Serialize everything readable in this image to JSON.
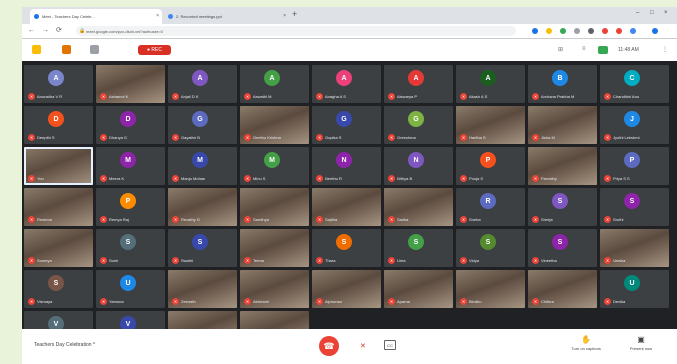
{
  "browser": {
    "tabs": [
      {
        "label": "Meet - Teachers Day Celebr...",
        "favicon_color": "#1a73e8",
        "active": true
      },
      {
        "label": "2. Recorded meetings.ppt",
        "favicon_color": "#4285f4",
        "active": false
      }
    ],
    "new_tab_symbol": "+",
    "win_controls": [
      "–",
      "□",
      "×"
    ],
    "url": "meet.google.com/pzc-dkcb-vnt?authuser=0",
    "nav_icons": [
      "←",
      "→",
      "⟳"
    ]
  },
  "meet_top": {
    "rec_label": "● REC",
    "clock": "11:48 AM",
    "right_icons": [
      "⊞",
      "≡",
      "⋮"
    ]
  },
  "participants": [
    {
      "initial": "A",
      "name": "Anuradha V R",
      "color": "#7986cb",
      "video": false
    },
    {
      "initial": "",
      "name": "Ashamol K",
      "color": "",
      "video": true
    },
    {
      "initial": "A",
      "name": "Anjali D K",
      "color": "#7e57c2",
      "video": false
    },
    {
      "initial": "A",
      "name": "Aswathi M",
      "color": "#43a047",
      "video": false
    },
    {
      "initial": "A",
      "name": "Anagha A S",
      "color": "#ec407a",
      "video": false
    },
    {
      "initial": "A",
      "name": "Aiswarya P",
      "color": "#e53935",
      "video": false
    },
    {
      "initial": "A",
      "name": "Akash A S",
      "color": "#1b5e20",
      "video": false
    },
    {
      "initial": "B",
      "name": "Archana Prabha M",
      "color": "#1e88e5",
      "video": false
    },
    {
      "initial": "C",
      "name": "Chandhini Anu",
      "color": "#00acc1",
      "video": false
    },
    {
      "initial": "D",
      "name": "Deepthi S",
      "color": "#f4511e",
      "video": false
    },
    {
      "initial": "D",
      "name": "Dhanya G",
      "color": "#8e24aa",
      "video": false
    },
    {
      "initial": "G",
      "name": "Gayathri B",
      "color": "#5c6bc0",
      "video": false
    },
    {
      "initial": "",
      "name": "Geethu Krishna",
      "color": "",
      "video": true
    },
    {
      "initial": "G",
      "name": "Gopika S",
      "color": "#3949ab",
      "video": false
    },
    {
      "initial": "G",
      "name": "Greeshma",
      "color": "#7cb342",
      "video": false
    },
    {
      "initial": "",
      "name": "Haritha S",
      "color": "",
      "video": true
    },
    {
      "initial": "",
      "name": "Jisha M",
      "color": "",
      "video": true
    },
    {
      "initial": "J",
      "name": "Jyothi Lekshmi",
      "color": "#1e88e5",
      "video": false
    },
    {
      "initial": "",
      "name": "You",
      "color": "",
      "video": true,
      "selected": true
    },
    {
      "initial": "M",
      "name": "Meera K",
      "color": "#8e24aa",
      "video": false
    },
    {
      "initial": "M",
      "name": "Manju Mohan",
      "color": "#3949ab",
      "video": false
    },
    {
      "initial": "M",
      "name": "Minu S",
      "color": "#43a047",
      "video": false
    },
    {
      "initial": "N",
      "name": "Neethu R",
      "color": "#8e24aa",
      "video": false
    },
    {
      "initial": "N",
      "name": "Nithya B",
      "color": "#7e57c2",
      "video": false
    },
    {
      "initial": "P",
      "name": "Pooja S",
      "color": "#f4511e",
      "video": false
    },
    {
      "initial": "",
      "name": "Parvathy",
      "color": "",
      "video": true
    },
    {
      "initial": "P",
      "name": "Priya S S",
      "color": "#5c6bc0",
      "video": false
    },
    {
      "initial": "",
      "name": "Reshma",
      "color": "",
      "video": true
    },
    {
      "initial": "P",
      "name": "Remya Raj",
      "color": "#fb8c00",
      "video": false
    },
    {
      "initial": "",
      "name": "Revathy G",
      "color": "",
      "video": true
    },
    {
      "initial": "",
      "name": "Sandhya",
      "color": "",
      "video": true
    },
    {
      "initial": "",
      "name": "Sajitha",
      "color": "",
      "video": true
    },
    {
      "initial": "",
      "name": "Sarika",
      "color": "",
      "video": true
    },
    {
      "initial": "R",
      "name": "Sneha",
      "color": "#5c6bc0",
      "video": false
    },
    {
      "initial": "S",
      "name": "Sreeja",
      "color": "#7e57c2",
      "video": false
    },
    {
      "initial": "S",
      "name": "Sruthi",
      "color": "#8e24aa",
      "video": false
    },
    {
      "initial": "",
      "name": "Soumya",
      "color": "",
      "video": true
    },
    {
      "initial": "S",
      "name": "Sumi",
      "color": "#546e7a",
      "video": false
    },
    {
      "initial": "S",
      "name": "Swathi",
      "color": "#3949ab",
      "video": false
    },
    {
      "initial": "",
      "name": "Teena",
      "color": "",
      "video": true
    },
    {
      "initial": "S",
      "name": "Thara",
      "color": "#ef6c00",
      "video": false
    },
    {
      "initial": "S",
      "name": "Uma",
      "color": "#43a047",
      "video": false
    },
    {
      "initial": "S",
      "name": "Vidya",
      "color": "#558b2f",
      "video": false
    },
    {
      "initial": "S",
      "name": "Vineetha",
      "color": "#8e24aa",
      "video": false
    },
    {
      "initial": "",
      "name": "Varsha",
      "color": "",
      "video": true
    },
    {
      "initial": "S",
      "name": "Vismaya",
      "color": "#795548",
      "video": false
    },
    {
      "initial": "U",
      "name": "Yamuna",
      "color": "#1e88e5",
      "video": false
    },
    {
      "initial": "",
      "name": "Zeenath",
      "color": "",
      "video": true
    },
    {
      "initial": "",
      "name": "Abhirami",
      "color": "",
      "video": true
    },
    {
      "initial": "",
      "name": "Alphonsa",
      "color": "",
      "video": true
    },
    {
      "initial": "",
      "name": "Aparna",
      "color": "",
      "video": true
    },
    {
      "initial": "",
      "name": "Bindhu",
      "color": "",
      "video": true
    },
    {
      "initial": "",
      "name": "Chithra",
      "color": "",
      "video": true
    },
    {
      "initial": "U",
      "name": "Devika",
      "color": "#00897b",
      "video": false
    },
    {
      "initial": "V",
      "name": "Divya",
      "color": "#546e7a",
      "video": false
    },
    {
      "initial": "V",
      "name": "Fathima",
      "color": "#3949ab",
      "video": false
    },
    {
      "initial": "",
      "name": "Gouri",
      "color": "",
      "video": true
    },
    {
      "initial": "",
      "name": "Hima",
      "color": "",
      "video": true
    }
  ],
  "bottom_bar": {
    "meeting_name": "Teachers Day Celebration ^",
    "end_call_icon": "☎",
    "cam_off_icon": "✕",
    "cc_label": "CC",
    "actions": [
      {
        "icon": "✋",
        "label": "Turn on captions"
      },
      {
        "icon": "▣",
        "label": "Present now"
      }
    ]
  },
  "colors": {
    "meet_dark": "#202124",
    "tile_bg": "#3c4043",
    "end_call": "#ea4335",
    "page_bg": "#e8f3da"
  }
}
